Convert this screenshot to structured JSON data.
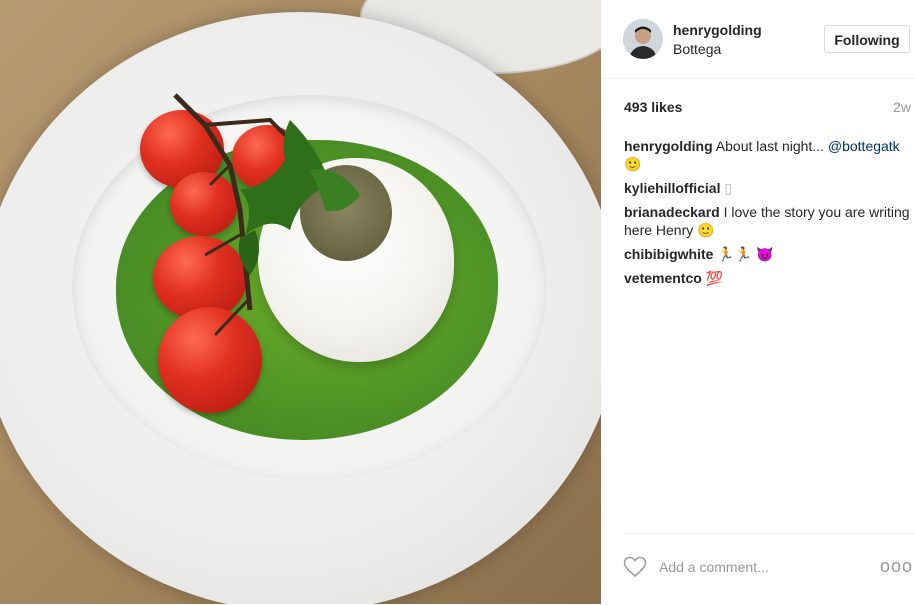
{
  "post": {
    "username": "henrygolding",
    "location": "Bottega",
    "follow_label": "Following",
    "likes": "493 likes",
    "time": "2w"
  },
  "comments": [
    {
      "user": "henrygolding",
      "text_before": "About last night... ",
      "mention": "@bottegatk",
      "text_after": "",
      "emoji": "🙂"
    },
    {
      "user": "kyliehillofficial",
      "text": "▯"
    },
    {
      "user": "brianadeckard",
      "text": "I love the story you are writing here Henry 🙂"
    },
    {
      "user": "chibibigwhite",
      "text": "🏃🏃 😈"
    },
    {
      "user": "vetementco",
      "text": "💯"
    }
  ],
  "footer": {
    "comment_placeholder": "Add a comment...",
    "more_label": "ooo"
  },
  "colors": {
    "mention": "#003569",
    "text": "#262626",
    "muted": "#999999",
    "border": "#dbdbdb"
  },
  "icons": {
    "like": "heart-icon",
    "options": "more-options-icon"
  }
}
